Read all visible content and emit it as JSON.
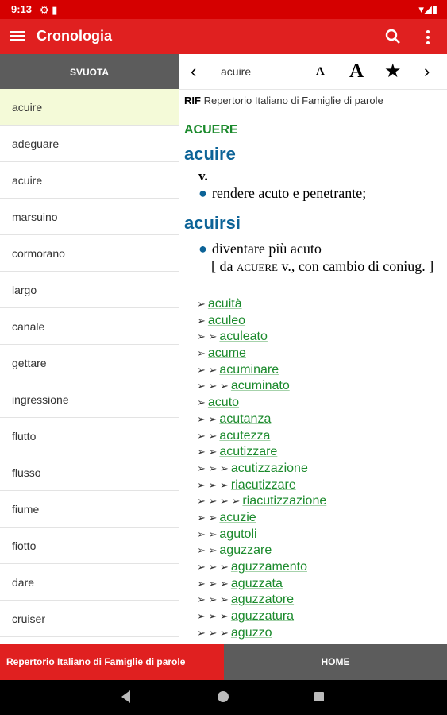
{
  "status": {
    "time": "9:13",
    "status_icons": "⚙ ▮",
    "right_icons": "▾◢▮"
  },
  "appbar": {
    "title": "Cronologia"
  },
  "left": {
    "clear_label": "SVUOTA",
    "history": [
      "acuire",
      "adeguare",
      "acuire",
      "marsuino",
      "cormorano",
      "largo",
      "canale",
      "gettare",
      "ingressione",
      "flutto",
      "flusso",
      "fiume",
      "fiotto",
      "dare",
      "cruiser"
    ]
  },
  "toolbar": {
    "prev": "‹",
    "word": "acuire",
    "font_small": "A",
    "font_large": "A",
    "star": "★",
    "next": "›"
  },
  "entry": {
    "source_abbr": "RIF",
    "source_name": " Repertorio Italiano di Famiglie di parole",
    "family_head": "ACUERE",
    "headword1": "acuire",
    "pos1": "v.",
    "def1": "rendere acuto e penetrante;",
    "headword2": "acuirsi",
    "def2": "diventare più acuto",
    "etym_open": "[ da ",
    "etym_sc": "acuere",
    "etym_rest": " v., con cambio di coniug. ]",
    "family": [
      {
        "prefix": "➢",
        "word": "acuità"
      },
      {
        "prefix": "➢",
        "word": "aculeo"
      },
      {
        "prefix": "➢ ➢",
        "word": "aculeato"
      },
      {
        "prefix": "➢",
        "word": "acume"
      },
      {
        "prefix": "➢ ➢",
        "word": "acuminare"
      },
      {
        "prefix": "➢ ➢ ➢",
        "word": "acuminato"
      },
      {
        "prefix": "➢",
        "word": "acuto"
      },
      {
        "prefix": "➢ ➢",
        "word": "acutanza"
      },
      {
        "prefix": "➢ ➢",
        "word": "acutezza"
      },
      {
        "prefix": "➢ ➢",
        "word": "acutizzare"
      },
      {
        "prefix": "➢ ➢ ➢",
        "word": "acutizzazione"
      },
      {
        "prefix": "➢ ➢ ➢",
        "word": "riacutizzare"
      },
      {
        "prefix": "➢ ➢ ➢ ➢",
        "word": "riacutizzazione"
      },
      {
        "prefix": "➢ ➢",
        "word": "acuzie"
      },
      {
        "prefix": "➢ ➢",
        "word": "agutoli"
      },
      {
        "prefix": "➢ ➢",
        "word": "aguzzare"
      },
      {
        "prefix": "➢ ➢ ➢",
        "word": "aguzzamento"
      },
      {
        "prefix": "➢ ➢ ➢",
        "word": "aguzzata"
      },
      {
        "prefix": "➢ ➢ ➢",
        "word": "aguzzatore"
      },
      {
        "prefix": "➢ ➢ ➢",
        "word": "aguzzatura"
      },
      {
        "prefix": "➢ ➢ ➢",
        "word": "aguzzo"
      }
    ]
  },
  "bottom": {
    "source_tab": "Repertorio Italiano di Famiglie di parole",
    "home_tab": "HOME"
  },
  "colors": {
    "accent": "#e02020",
    "statusbar": "#d50000",
    "link": "#1b8a2c",
    "headword": "#0c6397",
    "selected_row": "#f4fad8",
    "gray_button": "#5c5c5c"
  }
}
